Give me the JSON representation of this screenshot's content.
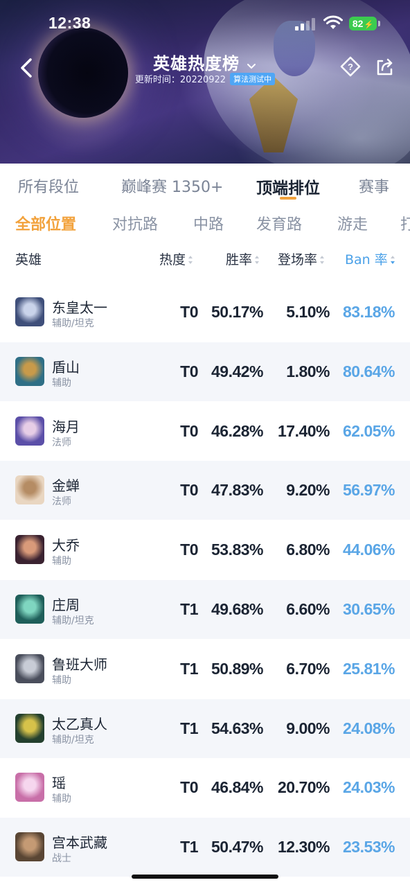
{
  "status_bar": {
    "time": "12:38",
    "battery": "82"
  },
  "header": {
    "title": "英雄热度榜",
    "updated_label": "更新时间：20220922",
    "algo_badge": "算法测试中"
  },
  "rank_tabs": [
    "所有段位",
    "巅峰赛 1350+",
    "顶端排位",
    "赛事"
  ],
  "active_rank_tab": "顶端排位",
  "position_tabs": [
    "全部位置",
    "对抗路",
    "中路",
    "发育路",
    "游走",
    "打"
  ],
  "active_position_tab": "全部位置",
  "columns": {
    "hero": "英雄",
    "heat": "热度",
    "win": "胜率",
    "pick": "登场率",
    "ban": "Ban 率"
  },
  "sort": {
    "column": "ban",
    "direction": "desc"
  },
  "accent_colors": {
    "orange": "#f2a23c",
    "blue": "#4ba1e8",
    "battery": "#3ccb4f"
  },
  "heroes": [
    {
      "name": "东皇太一",
      "role": "辅助/坦克",
      "tier": "T0",
      "win": "50.17%",
      "pick": "5.10%",
      "ban": "83.18%",
      "avatar_colors": [
        "#3f4f7a",
        "#c9d3ea"
      ]
    },
    {
      "name": "盾山",
      "role": "辅助",
      "tier": "T0",
      "win": "49.42%",
      "pick": "1.80%",
      "ban": "80.64%",
      "avatar_colors": [
        "#2f6f86",
        "#c89a4a"
      ]
    },
    {
      "name": "海月",
      "role": "法师",
      "tier": "T0",
      "win": "46.28%",
      "pick": "17.40%",
      "ban": "62.05%",
      "avatar_colors": [
        "#5b4fa8",
        "#e6cde6"
      ]
    },
    {
      "name": "金蝉",
      "role": "法师",
      "tier": "T0",
      "win": "47.83%",
      "pick": "9.20%",
      "ban": "56.97%",
      "avatar_colors": [
        "#e9d6c1",
        "#b58c64"
      ]
    },
    {
      "name": "大乔",
      "role": "辅助",
      "tier": "T0",
      "win": "53.83%",
      "pick": "6.80%",
      "ban": "44.06%",
      "avatar_colors": [
        "#3a2230",
        "#d99a7a"
      ]
    },
    {
      "name": "庄周",
      "role": "辅助/坦克",
      "tier": "T1",
      "win": "49.68%",
      "pick": "6.60%",
      "ban": "30.65%",
      "avatar_colors": [
        "#1f5f5a",
        "#7fd6c0"
      ]
    },
    {
      "name": "鲁班大师",
      "role": "辅助",
      "tier": "T1",
      "win": "50.89%",
      "pick": "6.70%",
      "ban": "25.81%",
      "avatar_colors": [
        "#4a4e5c",
        "#c8ccd6"
      ]
    },
    {
      "name": "太乙真人",
      "role": "辅助/坦克",
      "tier": "T1",
      "win": "54.63%",
      "pick": "9.00%",
      "ban": "24.08%",
      "avatar_colors": [
        "#24402e",
        "#d6c24a"
      ]
    },
    {
      "name": "瑶",
      "role": "辅助",
      "tier": "T0",
      "win": "46.84%",
      "pick": "20.70%",
      "ban": "24.03%",
      "avatar_colors": [
        "#c86fa8",
        "#f6d6ee"
      ]
    },
    {
      "name": "宫本武藏",
      "role": "战士",
      "tier": "T1",
      "win": "50.47%",
      "pick": "12.30%",
      "ban": "23.53%",
      "avatar_colors": [
        "#5a4634",
        "#c49a74"
      ]
    }
  ]
}
